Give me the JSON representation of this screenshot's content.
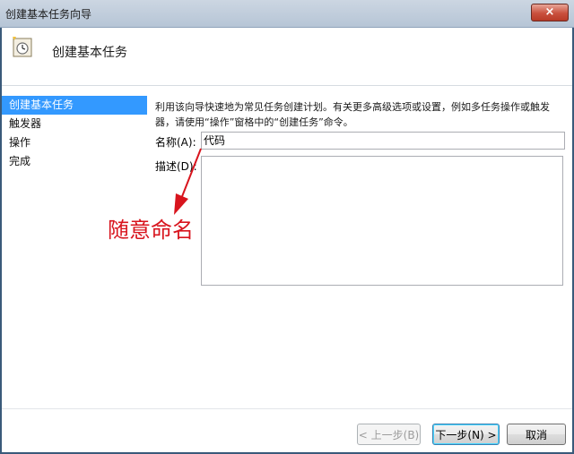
{
  "window": {
    "title": "创建基本任务向导",
    "close_label": "×"
  },
  "header": {
    "title": "创建基本任务",
    "icon": "task-scheduler-icon"
  },
  "sidebar": {
    "items": [
      {
        "label": "创建基本任务",
        "active": true
      },
      {
        "label": "触发器",
        "active": false
      },
      {
        "label": "操作",
        "active": false
      },
      {
        "label": "完成",
        "active": false
      }
    ]
  },
  "main": {
    "description": "利用该向导快速地为常见任务创建计划。有关更多高级选项或设置，例如多任务操作或触发器，请使用“操作”窗格中的“创建任务”命令。",
    "name_label": "名称(A):",
    "name_value": "代码",
    "desc_label": "描述(D):",
    "desc_value": ""
  },
  "annotation": {
    "text": "随意命名",
    "color": "#d8141d"
  },
  "buttons": {
    "back": "< 上一步(B)",
    "next": "下一步(N) >",
    "cancel": "取消"
  }
}
